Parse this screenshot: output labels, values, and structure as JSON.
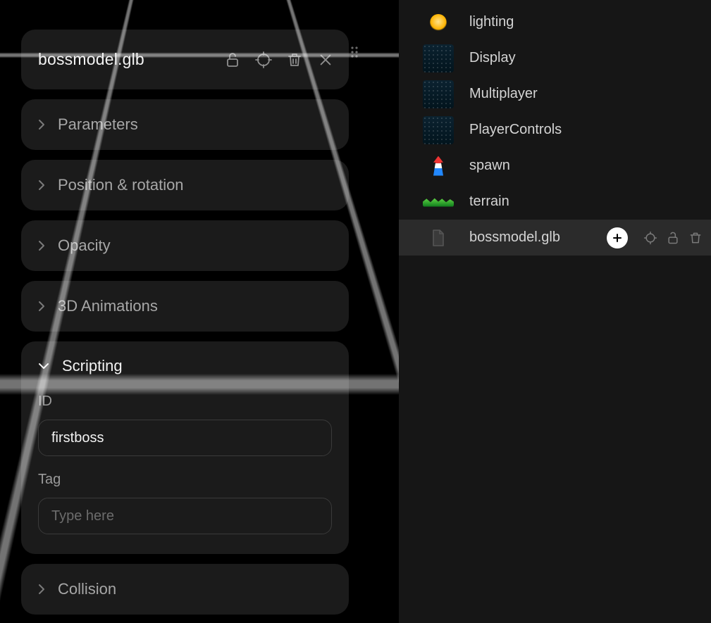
{
  "inspector": {
    "title": "bossmodel.glb",
    "sections": {
      "parameters": "Parameters",
      "position_rotation": "Position & rotation",
      "opacity": "Opacity",
      "animations": "3D Animations",
      "scripting": "Scripting",
      "collision": "Collision"
    },
    "scripting": {
      "id_label": "ID",
      "id_value": "firstboss",
      "tag_label": "Tag",
      "tag_placeholder": "Type here",
      "tag_value": ""
    }
  },
  "hierarchy": {
    "items": [
      {
        "label": "lighting",
        "thumb": "lighting"
      },
      {
        "label": "Display",
        "thumb": "tex"
      },
      {
        "label": "Multiplayer",
        "thumb": "tex"
      },
      {
        "label": "PlayerControls",
        "thumb": "tex"
      },
      {
        "label": "spawn",
        "thumb": "spawn"
      },
      {
        "label": "terrain",
        "thumb": "terrain"
      },
      {
        "label": "bossmodel.glb",
        "thumb": "file",
        "selected": true,
        "has_add": true,
        "has_actions": true
      }
    ]
  },
  "icons": {
    "unlock": "unlock-icon",
    "target": "target-icon",
    "trash": "trash-icon",
    "close": "close-icon",
    "drag": "drag-handle-icon",
    "chevron_right": "chevron-right-icon",
    "chevron_down": "chevron-down-icon",
    "plus": "plus-icon",
    "file": "file-icon"
  }
}
